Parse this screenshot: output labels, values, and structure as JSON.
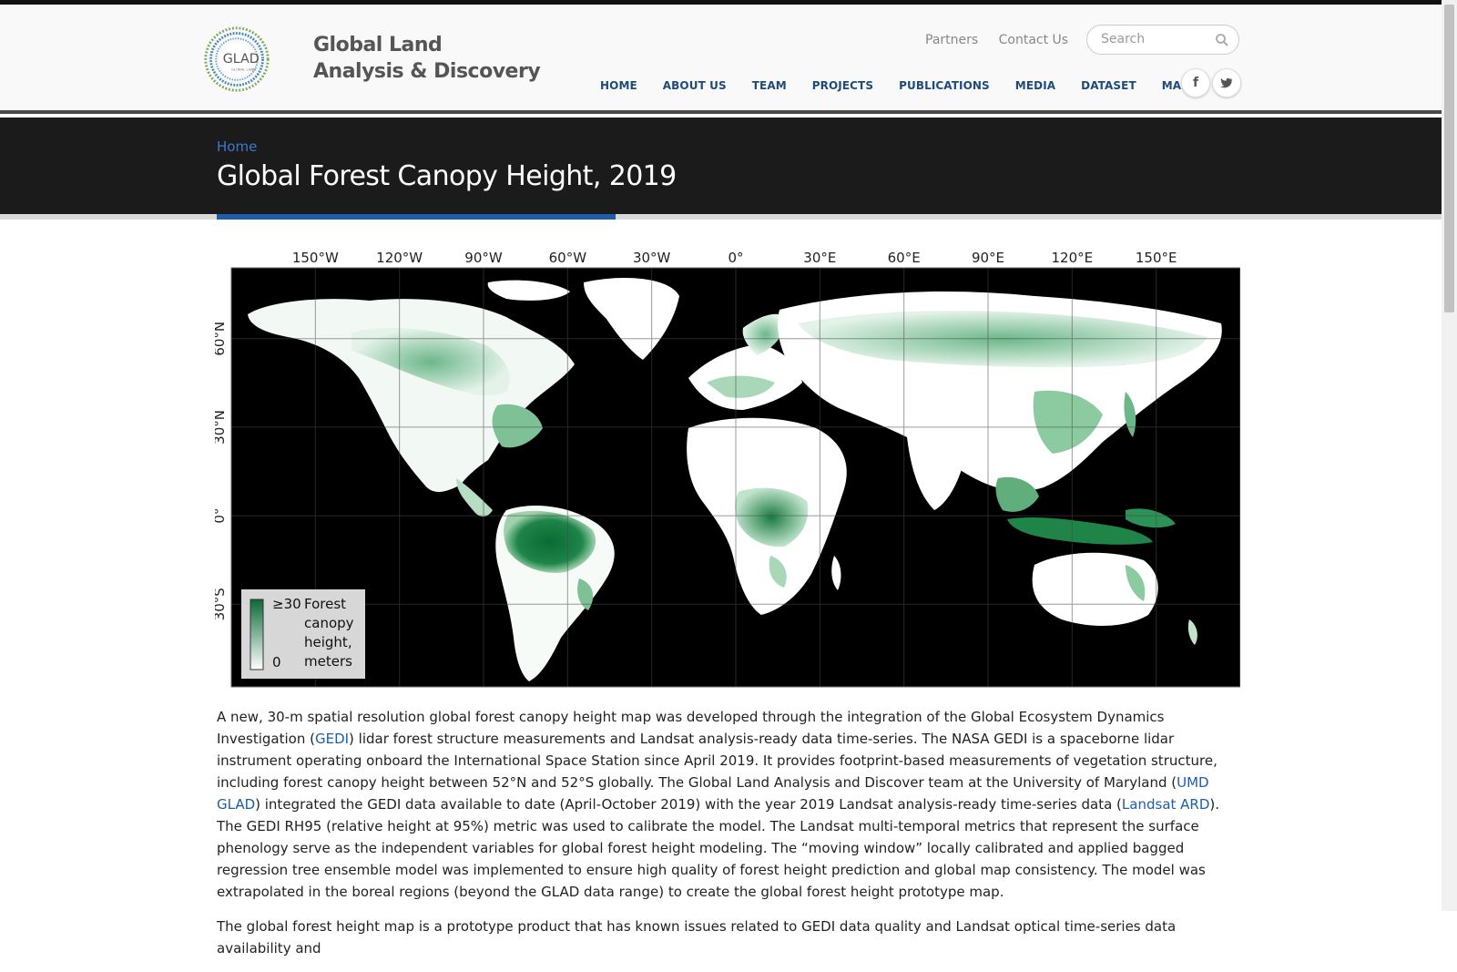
{
  "site": {
    "logo_text": "GLAD",
    "logo_subtext": "GLOBAL LAND ANALYSIS & DISCOVERY",
    "title_line1": "Global Land",
    "title_line2": "Analysis & Discovery"
  },
  "toplinks": {
    "partners": "Partners",
    "contact": "Contact Us"
  },
  "search": {
    "placeholder": "Search"
  },
  "nav": [
    "HOME",
    "ABOUT US",
    "TEAM",
    "PROJECTS",
    "PUBLICATIONS",
    "MEDIA",
    "DATASET",
    "MAPS"
  ],
  "social": {
    "facebook": "f",
    "twitter": "t"
  },
  "breadcrumb": "Home",
  "page_title": "Global Forest Canopy Height, 2019",
  "map": {
    "lon_labels": [
      "150°W",
      "120°W",
      "90°W",
      "60°W",
      "30°W",
      "0°",
      "30°E",
      "60°E",
      "90°E",
      "120°E",
      "150°E"
    ],
    "lat_labels": [
      "60°N",
      "30°N",
      "0°",
      "30°S"
    ],
    "legend_max": "≥30",
    "legend_min": "0",
    "legend_title": "Forest canopy height, meters",
    "legend_lines": [
      "Forest",
      "canopy",
      "height,",
      "meters"
    ],
    "colors": {
      "ocean": "#000000",
      "land_bare": "#ffffff",
      "forest_high": "#0b6a34",
      "forest_mid": "#5fae7c",
      "forest_low": "#c9e6d2"
    }
  },
  "body": {
    "p1_a": "A new, 30-m spatial resolution global forest canopy height map was developed through the integration of the Global Ecosystem Dynamics Investigation (",
    "link_gedi": "GEDI",
    "p1_b": ") lidar forest structure measurements and Landsat analysis-ready data time-series. The NASA GEDI is a spaceborne lidar instrument operating onboard the International Space Station since April 2019. It provides footprint-based measurements of vegetation structure, including forest canopy height between 52°N and 52°S globally. The Global Land Analysis and Discover team at the University of Maryland (",
    "link_umd": "UMD GLAD",
    "p1_c": ") integrated the GEDI data available to date (April-October 2019) with the year 2019 Landsat analysis-ready time-series data (",
    "link_landsat": "Landsat ARD",
    "p1_d": "). The GEDI RH95 (relative height at 95%) metric was used to calibrate the model. The Landsat multi-temporal metrics that represent the surface phenology serve as the independent variables for global forest height modeling. The “moving window” locally calibrated and applied bagged regression tree ensemble model was implemented to ensure high quality of forest height prediction and global map consistency. The model was extrapolated in the boreal regions (beyond the GLAD data range) to create the global forest height prototype map.",
    "p2": "The global forest height map is a prototype product that has known issues related to GEDI data quality and Landsat optical time-series data availability and"
  }
}
